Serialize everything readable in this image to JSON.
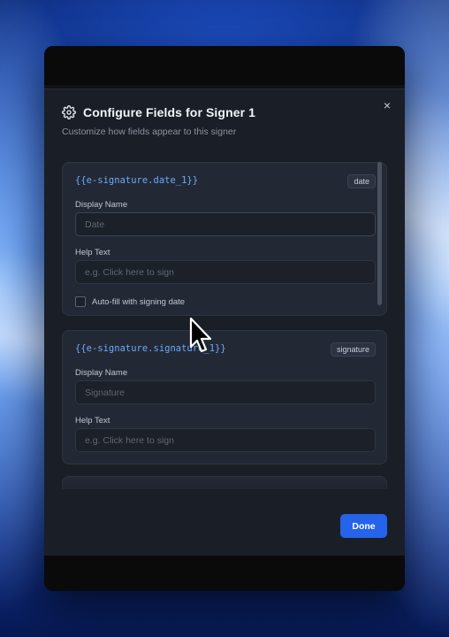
{
  "dialog": {
    "title": "Configure Fields for Signer 1",
    "subtitle": "Customize how fields appear to this signer",
    "close_symbol": "×",
    "done_label": "Done"
  },
  "fields": [
    {
      "key": "{{e-signature.date_1}}",
      "type": "date",
      "display_name_label": "Display Name",
      "display_name_value": "",
      "display_name_placeholder": "Date",
      "help_text_label": "Help Text",
      "help_text_value": "",
      "help_text_placeholder": "e.g. Click here to sign",
      "checkbox_label": "Auto-fill with signing date",
      "checkbox_checked": false
    },
    {
      "key": "{{e-signature.signature_1}}",
      "type": "signature",
      "display_name_label": "Display Name",
      "display_name_value": "",
      "display_name_placeholder": "Signature",
      "help_text_label": "Help Text",
      "help_text_value": "",
      "help_text_placeholder": "e.g. Click here to sign"
    }
  ],
  "icons": {
    "title_icon": "gear-icon",
    "close_icon": "close-icon",
    "pointer": "mouse-cursor-icon"
  },
  "colors": {
    "accent": "#2563eb",
    "code_key": "#6aa9ff",
    "dialog_bg": "#1a1e26",
    "card_bg": "#232934"
  }
}
